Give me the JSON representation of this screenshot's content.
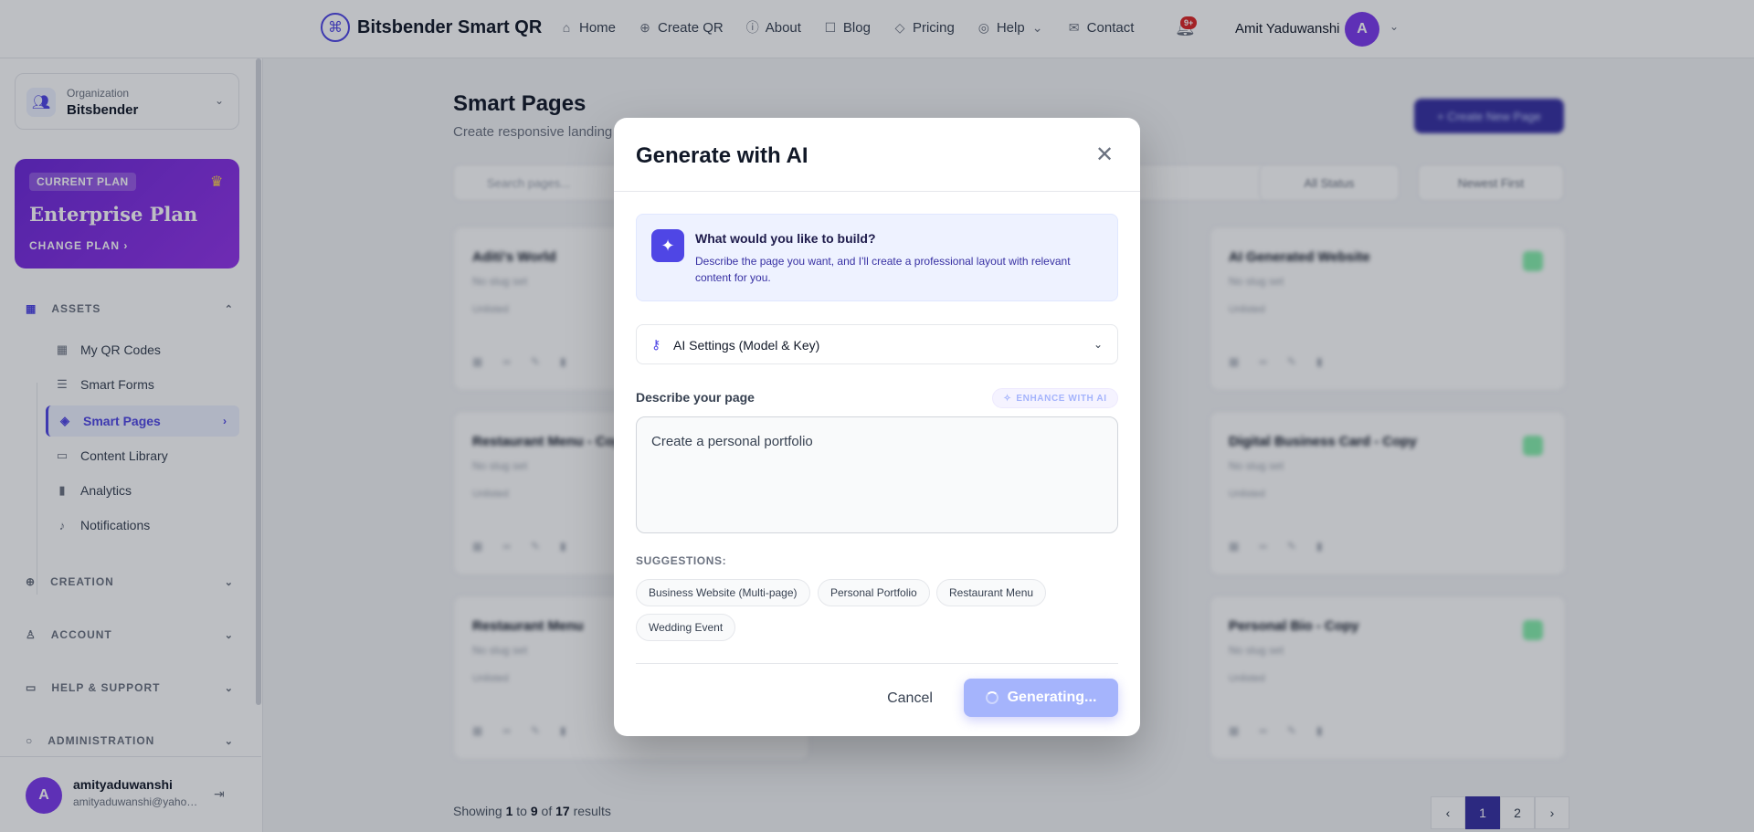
{
  "brand": {
    "name": "Bitsbender Smart QR",
    "logo_icon": "qr-logo-icon"
  },
  "nav": {
    "items": [
      {
        "label": "Home",
        "icon": "⌂"
      },
      {
        "label": "Create QR",
        "icon": "⊕"
      },
      {
        "label": "About",
        "icon": "ⓘ"
      },
      {
        "label": "Blog",
        "icon": "☐"
      },
      {
        "label": "Pricing",
        "icon": "◇"
      },
      {
        "label": "Help",
        "icon": "◎"
      },
      {
        "label": "Contact",
        "icon": "✉"
      }
    ],
    "help_chevron": "⌄",
    "notification_badge": "9+",
    "user_name": "Amit Yaduwanshi",
    "user_initial": "A"
  },
  "sidebar": {
    "org_label": "Organization",
    "org_name": "Bitsbender",
    "plan": {
      "badge": "CURRENT PLAN",
      "name": "Enterprise Plan",
      "change": "CHANGE PLAN ›"
    },
    "sections": {
      "assets": "ASSETS",
      "creation": "CREATION",
      "account": "ACCOUNT",
      "help": "HELP & SUPPORT",
      "admin": "ADMINISTRATION"
    },
    "items": [
      {
        "label": "My QR Codes",
        "icon": "▦"
      },
      {
        "label": "Smart Forms",
        "icon": "☰"
      },
      {
        "label": "Smart Pages",
        "icon": "◈"
      },
      {
        "label": "Content Library",
        "icon": "▭"
      },
      {
        "label": "Analytics",
        "icon": "▮"
      },
      {
        "label": "Notifications",
        "icon": "♪"
      }
    ],
    "profile": {
      "initial": "A",
      "name": "amityaduwanshi",
      "email": "amityaduwanshi@yahoo.com"
    }
  },
  "main": {
    "title": "Smart Pages",
    "subtitle": "Create responsive landing pages",
    "create_button": "+ Create New Page",
    "search_placeholder": "Search pages...",
    "filter_status": "All Status",
    "filter_sort": "Newest First",
    "cards": [
      {
        "title": "Aditi's World",
        "sub": "No slug set",
        "meta": "Unlisted"
      },
      {
        "title": "AI Generated Website",
        "sub": "No slug set",
        "meta": "Unlisted"
      },
      {
        "title": "Restaurant Menu - Copy",
        "sub": "No slug set",
        "meta": "Unlisted"
      },
      {
        "title": "Digital Business Card - Copy",
        "sub": "No slug set",
        "meta": "Unlisted"
      },
      {
        "title": "Restaurant Menu",
        "sub": "No slug set",
        "meta": "Unlisted"
      },
      {
        "title": "Personal Bio - Copy",
        "sub": "No slug set",
        "meta": "Unlisted"
      }
    ],
    "showing": {
      "prefix": "Showing",
      "from": "1",
      "to_word": "to",
      "to": "9",
      "of_word": "of",
      "total": "17",
      "suffix": "results"
    },
    "pager": {
      "prev": "‹",
      "current": "1",
      "next_page": "2",
      "next": "›"
    }
  },
  "modal": {
    "title": "Generate with AI",
    "close": "✕",
    "info_title": "What would you like to build?",
    "info_text": "Describe the page you want, and I'll create a professional layout with relevant content for you.",
    "ai_settings": "AI Settings (Model & Key)",
    "desc_label": "Describe your page",
    "enhance": "ENHANCE WITH AI",
    "prompt_value": "Create a personal portfolio",
    "suggestions_label": "SUGGESTIONS:",
    "suggestions": [
      "Business Website (Multi-page)",
      "Personal Portfolio",
      "Restaurant Menu",
      "Wedding Event"
    ],
    "cancel": "Cancel",
    "generating": "Generating..."
  },
  "colors": {
    "accent": "#4f46e5",
    "plan_gradient_start": "#6d28d9",
    "plan_gradient_end": "#9333ea",
    "generate_disabled": "#a5b4fc"
  }
}
